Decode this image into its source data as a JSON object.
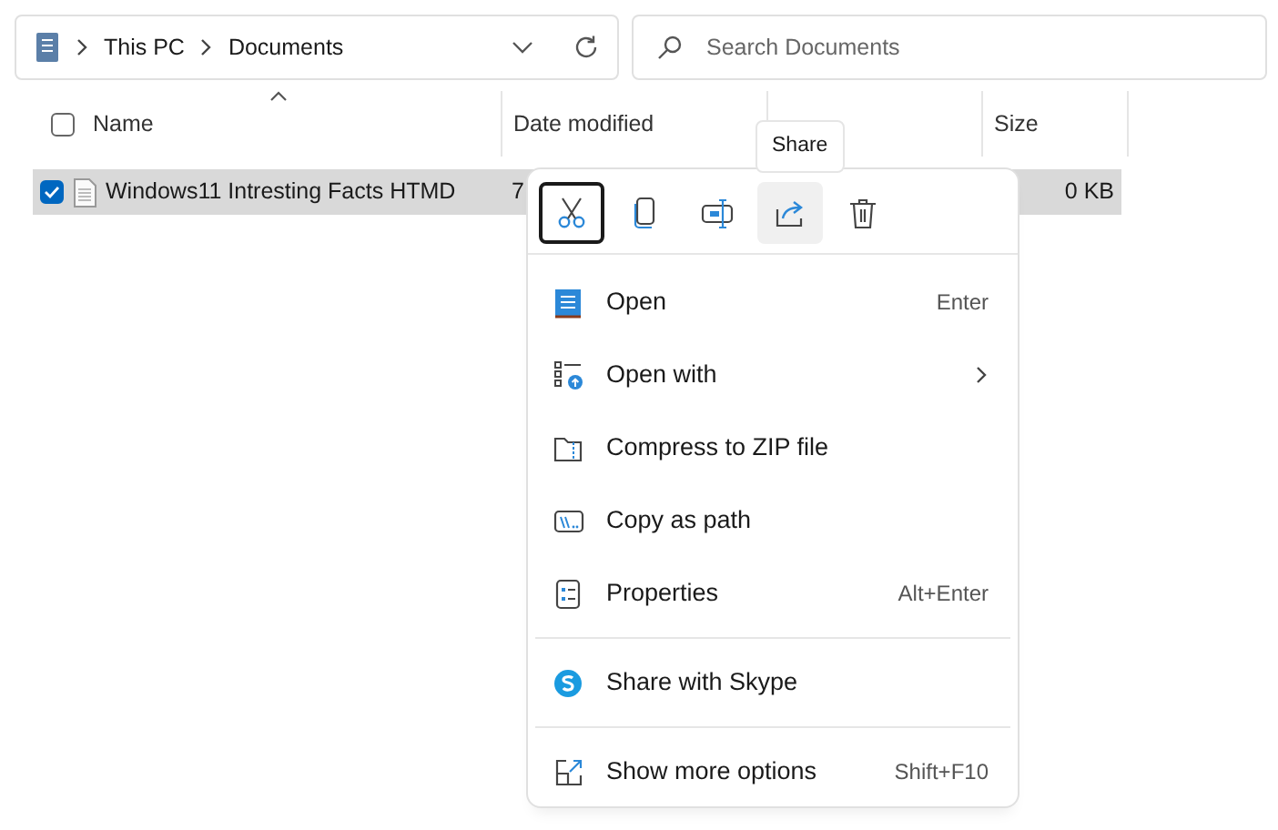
{
  "address_bar": {
    "path": [
      "This PC",
      "Documents"
    ]
  },
  "search": {
    "placeholder": "Search Documents"
  },
  "columns": [
    {
      "kind": "text",
      "label": "Name",
      "sorted": true
    },
    {
      "kind": "text",
      "label": "Date modified",
      "sorted": false
    },
    {
      "kind": "blank",
      "sorted": false
    },
    {
      "kind": "text",
      "label": "Size",
      "sorted": false
    }
  ],
  "select_all": {
    "checked": false
  },
  "rows": [
    {
      "name": "Windows11 Intresting Facts HTMD",
      "date": "7",
      "size": "0 KB",
      "selected": true,
      "checked": true
    }
  ],
  "tooltip": "Share",
  "context_menu": {
    "toolbar": [
      {
        "kind": "cut",
        "focused": true,
        "hovered": false
      },
      {
        "kind": "copy",
        "focused": false,
        "hovered": false
      },
      {
        "kind": "rename",
        "focused": false,
        "hovered": false
      },
      {
        "kind": "share",
        "focused": false,
        "hovered": true
      },
      {
        "kind": "delete",
        "focused": false,
        "hovered": false
      }
    ],
    "groups": [
      [
        {
          "kind": "open",
          "label": "Open",
          "shortcut": "Enter",
          "submenu": false
        },
        {
          "kind": "openwith",
          "label": "Open with",
          "submenu": true
        },
        {
          "kind": "zip",
          "label": "Compress to ZIP file",
          "submenu": false
        },
        {
          "kind": "path",
          "label": "Copy as path",
          "submenu": false
        },
        {
          "kind": "props",
          "label": "Properties",
          "shortcut": "Alt+Enter",
          "submenu": false
        }
      ],
      [
        {
          "kind": "skype",
          "label": "Share with Skype",
          "submenu": false
        }
      ],
      [
        {
          "kind": "more",
          "label": "Show more options",
          "shortcut": "Shift+F10",
          "submenu": false
        }
      ]
    ]
  }
}
